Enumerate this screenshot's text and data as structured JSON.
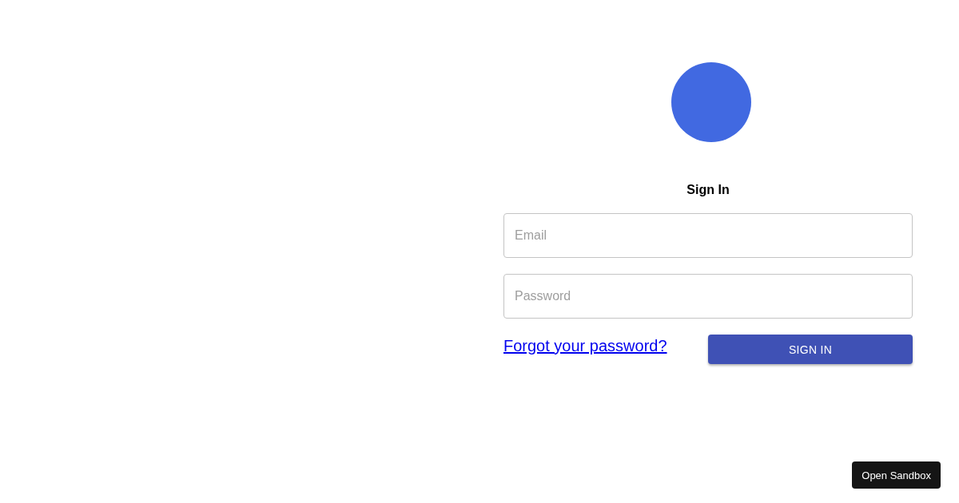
{
  "form": {
    "title": "Sign In",
    "fields": [
      {
        "placeholder": "Email"
      },
      {
        "placeholder": "Password"
      }
    ],
    "forgot_link": "Forgot your password?",
    "submit_button": "SIGN IN"
  },
  "sandbox_button": "Open Sandbox"
}
